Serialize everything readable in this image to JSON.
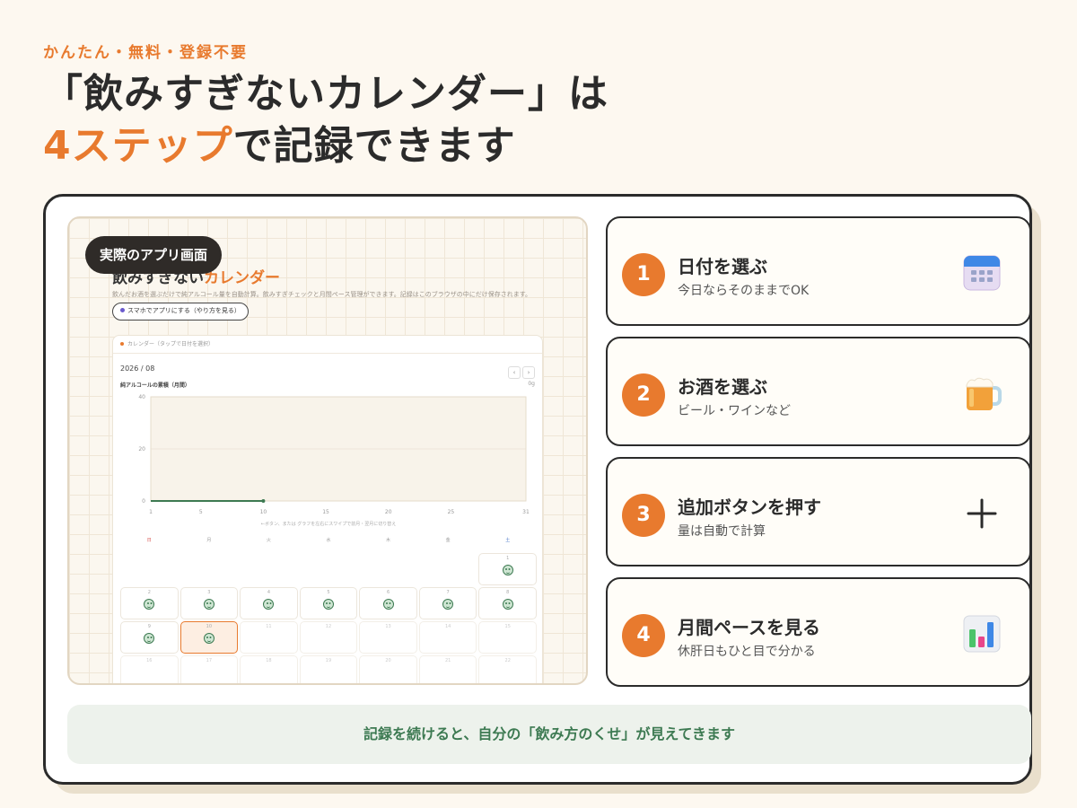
{
  "header": {
    "eyebrow": "かんたん・無料・登録不要",
    "title_line1": "「飲みすぎないカレンダー」は",
    "title_accent": "4ステップ",
    "title_line2_rest": "で記録できます"
  },
  "preview": {
    "badge": "実際のアプリ画面",
    "app_title_main": "飲みすぎない",
    "app_title_accent": "カレンダー",
    "app_desc": "飲んだお酒を選ぶだけで純アルコール量を自動計算。飲みすぎチェックと月間ペース管理ができます。記録はこのブラウザの中にだけ保存されます。",
    "app_pill": "スマホでアプリにする（やり方を見る）",
    "calendar_header": "カレンダー（タップで日付を選択）",
    "month": "2026 / 08",
    "prev_label": "‹",
    "next_label": "›",
    "chart_title": "純アルコールの累積（月間）",
    "chart_unit": "0g",
    "chart_note": "←ボタン、または グラフを左右にスワイプで前月・翌月に切り替え",
    "weekdays": [
      "日",
      "月",
      "火",
      "水",
      "木",
      "金",
      "土"
    ],
    "days_row1": [
      "1"
    ],
    "days_row2": [
      "2",
      "3",
      "4",
      "5",
      "6",
      "7",
      "8"
    ],
    "days_row3": [
      "9",
      "10",
      "11",
      "12",
      "13",
      "14",
      "15"
    ],
    "days_row4": [
      "16",
      "17",
      "18",
      "19",
      "20",
      "21",
      "22"
    ]
  },
  "chart_data": {
    "type": "line",
    "x": [
      1,
      10
    ],
    "values": [
      0,
      0
    ],
    "xticks": [
      "1",
      "5",
      "10",
      "15",
      "20",
      "25",
      "31"
    ],
    "yticks": [
      "0",
      "20",
      "40"
    ],
    "ylim": [
      0,
      40
    ],
    "xlim": [
      1,
      31
    ]
  },
  "steps": [
    {
      "num": "1",
      "title": "日付を選ぶ",
      "sub": "今日ならそのままでOK",
      "icon": "calendar-icon"
    },
    {
      "num": "2",
      "title": "お酒を選ぶ",
      "sub": "ビール・ワインなど",
      "icon": "beer-mug-icon"
    },
    {
      "num": "3",
      "title": "追加ボタンを押す",
      "sub": "量は自動で計算",
      "icon": "plus-icon"
    },
    {
      "num": "4",
      "title": "月間ペースを見る",
      "sub": "休肝日もひと目で分かる",
      "icon": "bar-chart-icon"
    }
  ],
  "footer": {
    "message": "記録を続けると、自分の「飲み方のくせ」が見えてきます"
  },
  "colors": {
    "accent": "#e87a2e",
    "green": "#3d7a52",
    "background": "#fdf8f0"
  }
}
